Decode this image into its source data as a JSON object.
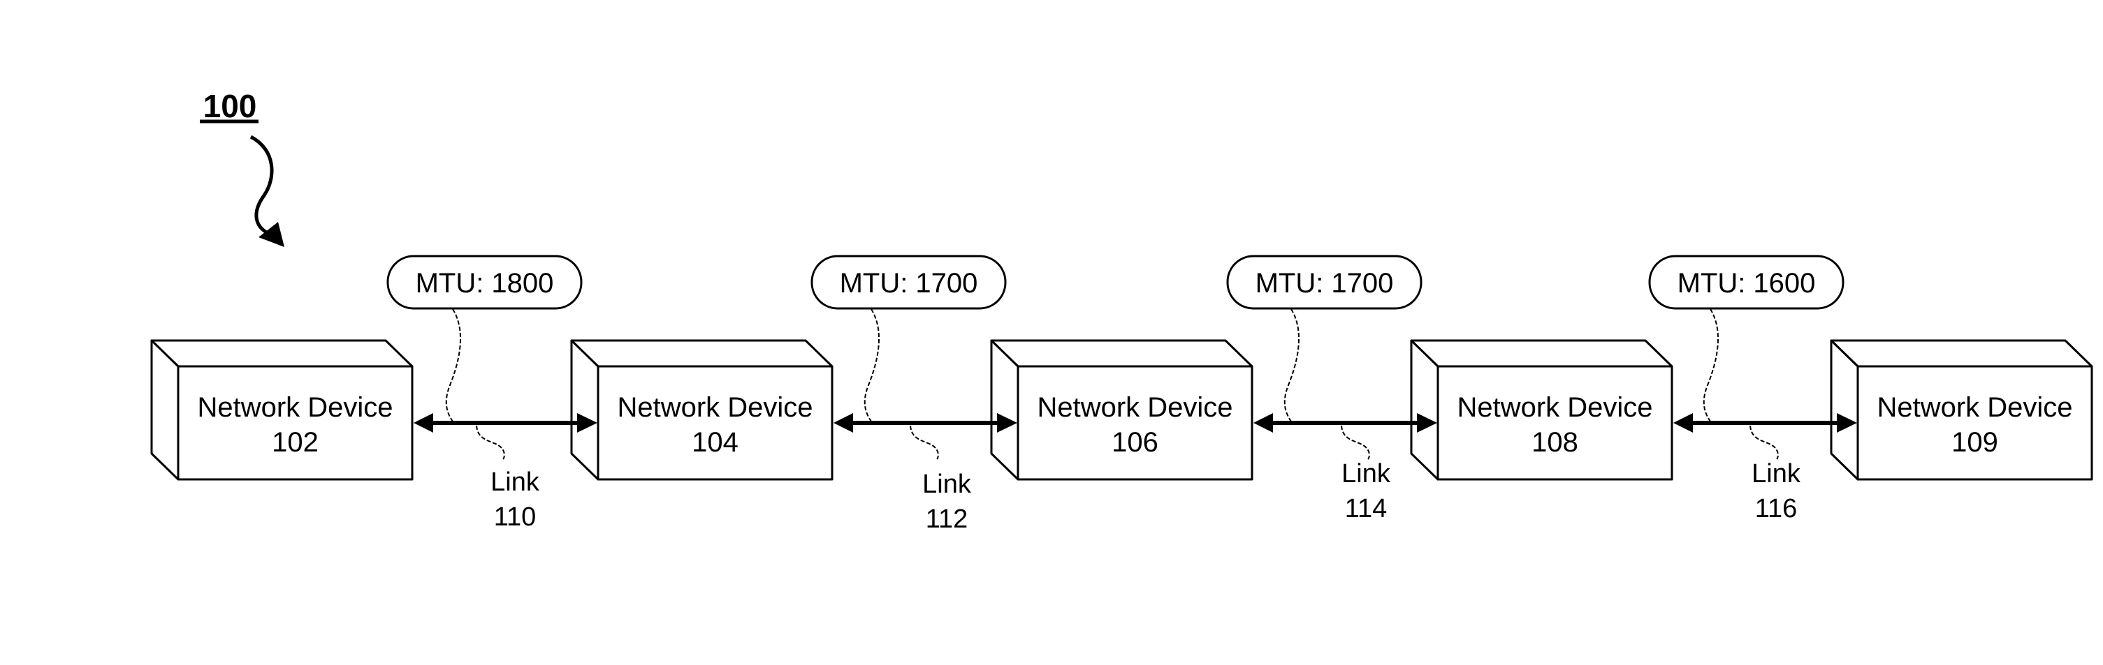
{
  "figure": {
    "label": "100"
  },
  "devices": [
    {
      "name": "Network Device",
      "id": "102"
    },
    {
      "name": "Network Device",
      "id": "104"
    },
    {
      "name": "Network Device",
      "id": "106"
    },
    {
      "name": "Network Device",
      "id": "108"
    },
    {
      "name": "Network Device",
      "id": "109"
    }
  ],
  "links": [
    {
      "label": "Link",
      "id": "110",
      "mtu": "MTU: 1800",
      "from": "102",
      "to": "104"
    },
    {
      "label": "Link",
      "id": "112",
      "mtu": "MTU: 1700",
      "from": "104",
      "to": "106"
    },
    {
      "label": "Link",
      "id": "114",
      "mtu": "MTU: 1700",
      "from": "106",
      "to": "108"
    },
    {
      "label": "Link",
      "id": "116",
      "mtu": "MTU: 1600",
      "from": "108",
      "to": "109"
    }
  ],
  "colors": {
    "stroke": "#000000",
    "background": "#ffffff"
  }
}
